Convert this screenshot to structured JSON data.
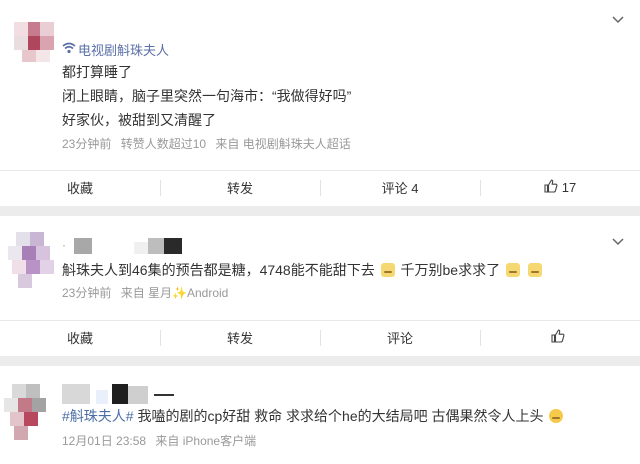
{
  "posts": [
    {
      "user": "电视剧斛珠夫人",
      "lines": [
        "都打算睡了",
        "闭上眼睛，脑子里突然一句海市：“我做得好吗”",
        "好家伙，被甜到又清醒了"
      ],
      "meta": [
        "23分钟前",
        "转赞人数超过10",
        "来自 电视剧斛珠夫人超话"
      ],
      "actions": {
        "collect": "收藏",
        "repost": "转发",
        "comment": "评论 4",
        "like": "17"
      }
    },
    {
      "user": "·",
      "text_before": "斛珠夫人到46集的预告都是糖，4748能不能甜下去",
      "text_middle": "千万别be求求了",
      "meta": [
        "23分钟前",
        "来自 星月✨Android"
      ],
      "actions": {
        "collect": "收藏",
        "repost": "转发",
        "comment": "评论",
        "like": ""
      }
    },
    {
      "tag": "#斛珠夫人#",
      "text": "我嗑的剧的cp好甜 救命 求求给个he的大结局吧 古偶果然令人上头",
      "meta": [
        "12月01日 23:58",
        "来自 iPhone客户端"
      ]
    }
  ],
  "colors": {
    "link": "#5a6fa8",
    "meta": "#999999",
    "background": "#ececec"
  }
}
